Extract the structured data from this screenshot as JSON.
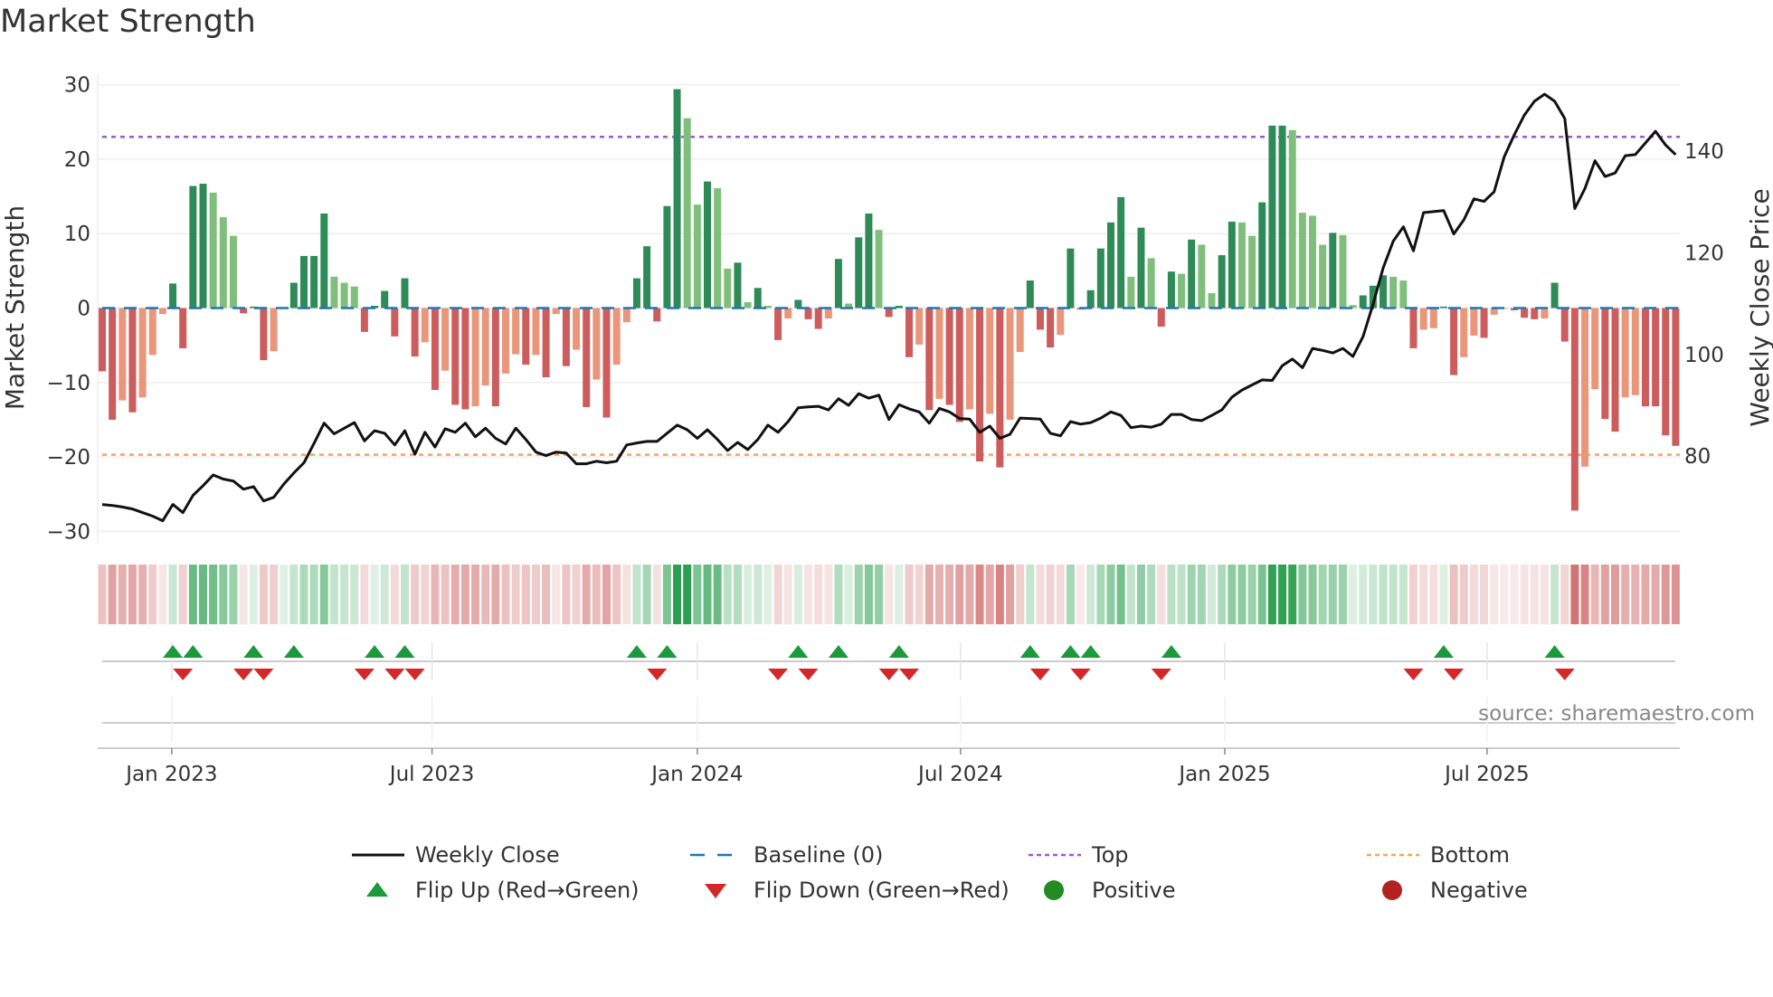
{
  "chart_data": {
    "type": "bar",
    "title": "Market Strength",
    "ylabel": "Market Strength",
    "y2label": "Weekly Close Price",
    "ylim": [
      -30,
      30
    ],
    "y2ticks": [
      80,
      100,
      120,
      140
    ],
    "yticks": [
      {
        "v": 30,
        "label": "30"
      },
      {
        "v": 20,
        "label": "20"
      },
      {
        "v": 10,
        "label": "10"
      },
      {
        "v": 0,
        "label": "0"
      },
      {
        "v": -10,
        "label": "−10"
      },
      {
        "v": -20,
        "label": "−20"
      },
      {
        "v": -30,
        "label": "−30"
      }
    ],
    "xticks": [
      {
        "week": 6.9,
        "label": "Jan 2023"
      },
      {
        "week": 32.7,
        "label": "Jul 2023"
      },
      {
        "week": 59.0,
        "label": "Jan 2024"
      },
      {
        "week": 85.1,
        "label": "Jul 2024"
      },
      {
        "week": 111.3,
        "label": "Jan 2025"
      },
      {
        "week": 137.3,
        "label": "Jul 2025"
      }
    ],
    "top_level": 23,
    "bottom_level": -19.7,
    "baseline": 0,
    "strength": [
      -8.5,
      -15,
      -12.4,
      -14,
      -12,
      -6.3,
      -0.8,
      3.3,
      -5.4,
      16.4,
      16.7,
      15.5,
      12.2,
      9.7,
      -0.7,
      0.2,
      -7,
      -5.8,
      0,
      3.4,
      7,
      7,
      12.7,
      4.2,
      3.4,
      2.9,
      -3.2,
      0.3,
      2.3,
      -3.8,
      4,
      -6.5,
      -4.6,
      -11,
      -8.4,
      -13,
      -13.6,
      -13.2,
      -10.4,
      -13.2,
      -8.8,
      -6.2,
      -7.6,
      -6.3,
      -9.3,
      -0.8,
      -7.8,
      -5.6,
      -13.3,
      -9.6,
      -14.7,
      -7.6,
      -1.9,
      4,
      8.3,
      -1.8,
      13.7,
      29.4,
      25.5,
      13.9,
      17,
      16.1,
      5.3,
      6.1,
      0.8,
      2.7,
      0.3,
      -4.3,
      -1.4,
      1.1,
      -1.5,
      -2.8,
      -1.4,
      6.6,
      0.6,
      9.5,
      12.7,
      10.5,
      -1.2,
      0.3,
      -6.6,
      -4.9,
      -13.7,
      -12.2,
      -13,
      -15.3,
      -13.6,
      -20.6,
      -14.2,
      -21.4,
      -15,
      -5.9,
      3.7,
      -2.9,
      -5.3,
      -3.6,
      8,
      -0.2,
      2.4,
      8,
      11.5,
      14.9,
      4.2,
      10.8,
      6.7,
      -2.5,
      4.9,
      4.6,
      9.2,
      8.5,
      2,
      7.1,
      11.6,
      11.5,
      9.7,
      14.2,
      24.5,
      24.5,
      23.9,
      12.8,
      12.4,
      8.5,
      10.1,
      9.8,
      0.4,
      1.7,
      3,
      4.4,
      4.2,
      3.7,
      -5.4,
      -2.9,
      -2.7,
      0.2,
      -9,
      -6.6,
      -3.7,
      -4,
      -0.9,
      -0.1,
      -0.3,
      -1.3,
      -1.5,
      -1.4,
      3.4,
      -4.5,
      -27.2,
      -21.3,
      -10.9,
      -14.9,
      -16.6,
      -12,
      -11.7,
      -13.2,
      -13.2,
      -17.1,
      -18.5
    ],
    "weekly_close": [
      70.5,
      70.3,
      70.0,
      69.6,
      68.9,
      68.2,
      67.3,
      70.5,
      68.9,
      72.3,
      74.2,
      76.3,
      75.5,
      75.1,
      73.5,
      74,
      71.2,
      71.9,
      74.5,
      76.7,
      78.7,
      82.5,
      86.5,
      84.4,
      85.5,
      86.6,
      83,
      85,
      84.5,
      82.2,
      85,
      80.4,
      84.7,
      81.8,
      85.4,
      84.7,
      86.5,
      83.8,
      85.5,
      83.5,
      82.4,
      85.5,
      83.3,
      80.8,
      80.1,
      80.8,
      80.6,
      78.5,
      78.5,
      79,
      78.7,
      79,
      82.2,
      82.6,
      82.9,
      82.9,
      84.5,
      86.1,
      85.2,
      83.5,
      85.2,
      83.3,
      81.1,
      82.7,
      81.3,
      83.3,
      86.1,
      84.7,
      86.8,
      89.5,
      89.7,
      89.8,
      89.1,
      91.3,
      90,
      92.3,
      91.4,
      92,
      87.2,
      90.1,
      89.3,
      88.7,
      86.5,
      89.4,
      88.7,
      87.4,
      87.3,
      84.7,
      85.9,
      83.5,
      84.3,
      87.5,
      87.4,
      87.3,
      84.5,
      84,
      86.8,
      86.3,
      86.6,
      87.5,
      88.7,
      88,
      85.6,
      85.9,
      85.7,
      86.3,
      88.2,
      88.2,
      87.2,
      87,
      88,
      89.1,
      91.6,
      93,
      94,
      95,
      94.9,
      97.8,
      99.1,
      97.4,
      101.2,
      100.8,
      100.3,
      101.2,
      99.6,
      103.5,
      109.9,
      117,
      122.3,
      125.1,
      120.4,
      127.9,
      128.1,
      128.3,
      123.7,
      126.5,
      130.6,
      130.1,
      132,
      138.9,
      143.2,
      147.1,
      149.8,
      151.2,
      149.8,
      146.4,
      128.7,
      132.6,
      138.1,
      135,
      135.7,
      139.1,
      139.3,
      141.6,
      143.9,
      141.2,
      139.3
    ],
    "flips_up": [
      7,
      9,
      15,
      19,
      27,
      30,
      53,
      56,
      69,
      73,
      79,
      92,
      96,
      98,
      106,
      133,
      144
    ],
    "flips_down": [
      8,
      14,
      16,
      26,
      29,
      31,
      55,
      67,
      70,
      78,
      80,
      93,
      97,
      105,
      130,
      134,
      145
    ],
    "legend": [
      {
        "label": "Weekly Close",
        "kind": "line",
        "color": "#111111"
      },
      {
        "label": "Baseline (0)",
        "kind": "dash",
        "color": "#1f77b4"
      },
      {
        "label": "Top",
        "kind": "dot",
        "color": "#9b59d0"
      },
      {
        "label": "Bottom",
        "kind": "dot",
        "color": "#f4a460"
      },
      {
        "label": "Flip Up (Red→Green)",
        "kind": "up",
        "color": "#1a9a3a"
      },
      {
        "label": "Flip Down (Green→Red)",
        "kind": "down",
        "color": "#d62728"
      },
      {
        "label": "Positive",
        "kind": "circle",
        "color": "#228b22"
      },
      {
        "label": "Negative",
        "kind": "circle",
        "color": "#b22222"
      }
    ],
    "legend_placement": "bottom"
  },
  "colors": {
    "pos_up": "#2e8b57",
    "pos_down": "#7fbf7b",
    "neg_down": "#cd5c5c",
    "neg_up": "#e9967a"
  },
  "source": "source: sharemaestro.com"
}
